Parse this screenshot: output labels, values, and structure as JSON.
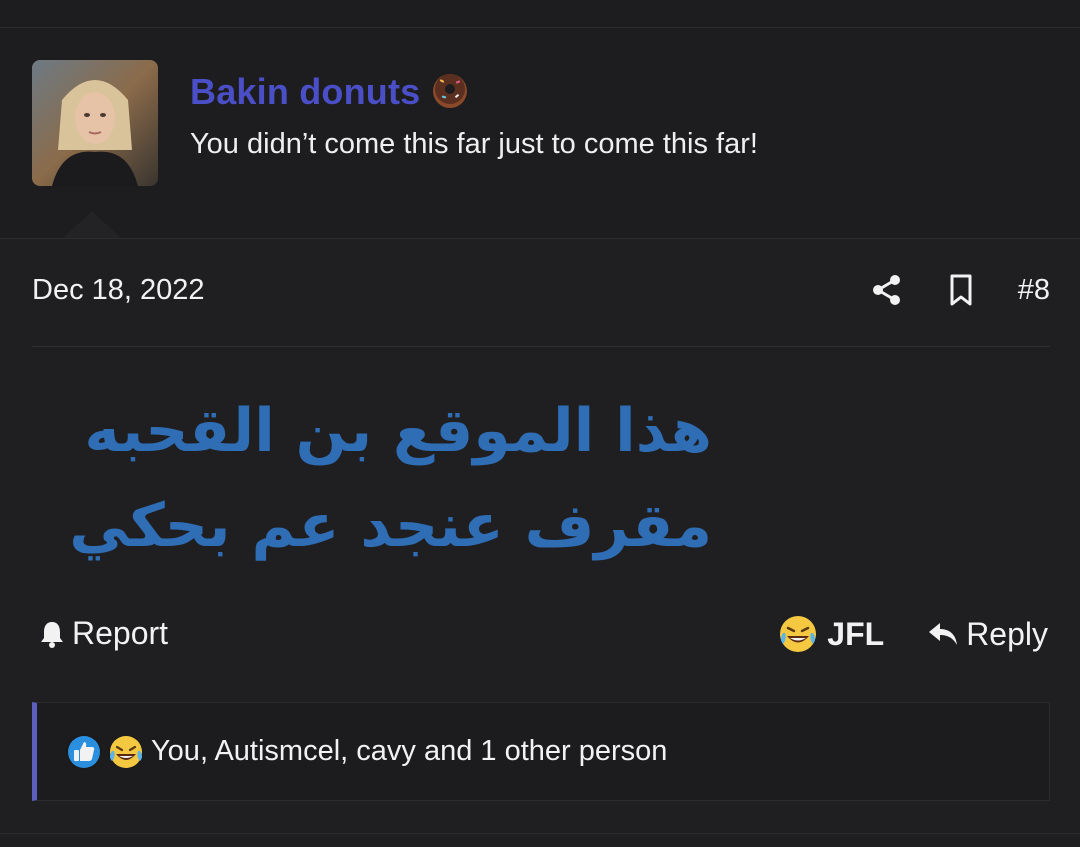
{
  "author": {
    "name": "Bakin donuts",
    "name_emoji_icon": "donut-icon",
    "signature": "You didn’t come this far just to come this far!"
  },
  "post": {
    "date": "Dec 18, 2022",
    "number": "#8",
    "body": "هذا الموقع بن القحبه مقرف عنجد عم بحكي",
    "body_color": "#2f6db5"
  },
  "actions": {
    "report_label": "Report",
    "jfl_label": "JFL",
    "reply_label": "Reply"
  },
  "reactions": {
    "icons": [
      "like-icon",
      "laughing-crying-icon"
    ],
    "summary": "You, Autismcel, cavy and 1 other person"
  },
  "colors": {
    "username": "#4b4fc7",
    "reaction_border": "#5c5fc0",
    "background": "#1d1d1f"
  }
}
